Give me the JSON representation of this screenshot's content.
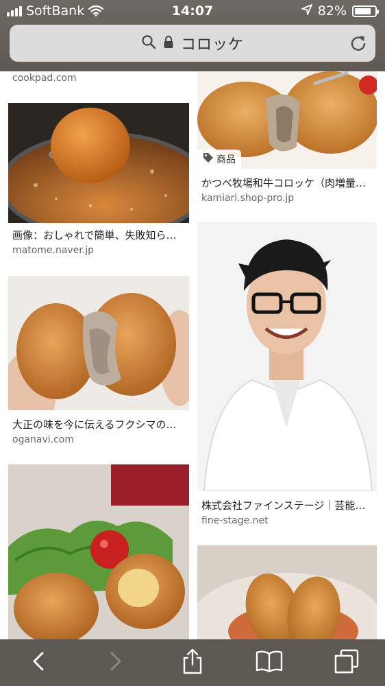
{
  "status_bar": {
    "carrier": "SoftBank",
    "time": "14:07",
    "battery_percent": "82%",
    "battery_level": 0.82
  },
  "url_bar": {
    "query": "コロッケ",
    "icons": [
      "search-icon",
      "lock-icon",
      "reload-icon"
    ]
  },
  "results": {
    "left": [
      {
        "caption": "",
        "domain": "cookpad.com"
      },
      {
        "caption": "画像：おしゃれで簡単、失敗知ら…",
        "domain": "matome.naver.jp"
      },
      {
        "caption": "大正の味を今に伝えるフクシマの…",
        "domain": "oganavi.com"
      },
      {
        "caption": "",
        "domain": ""
      }
    ],
    "right": [
      {
        "badge": "商品",
        "caption": "かつべ牧場和牛コロッケ（肉増量…",
        "domain": "kamiari.shop-pro.jp"
      },
      {
        "caption": "株式会社ファインステージ｜芸能…",
        "domain": "fine-stage.net"
      },
      {
        "caption": "",
        "domain": ""
      }
    ]
  },
  "toolbar": {
    "icons": [
      "back-icon",
      "forward-icon",
      "share-icon",
      "bookmarks-icon",
      "tabs-icon"
    ]
  },
  "colors": {
    "chrome": "#5f5954",
    "urlbar": "#dcdcdc",
    "croquette": "#d28a3a"
  }
}
